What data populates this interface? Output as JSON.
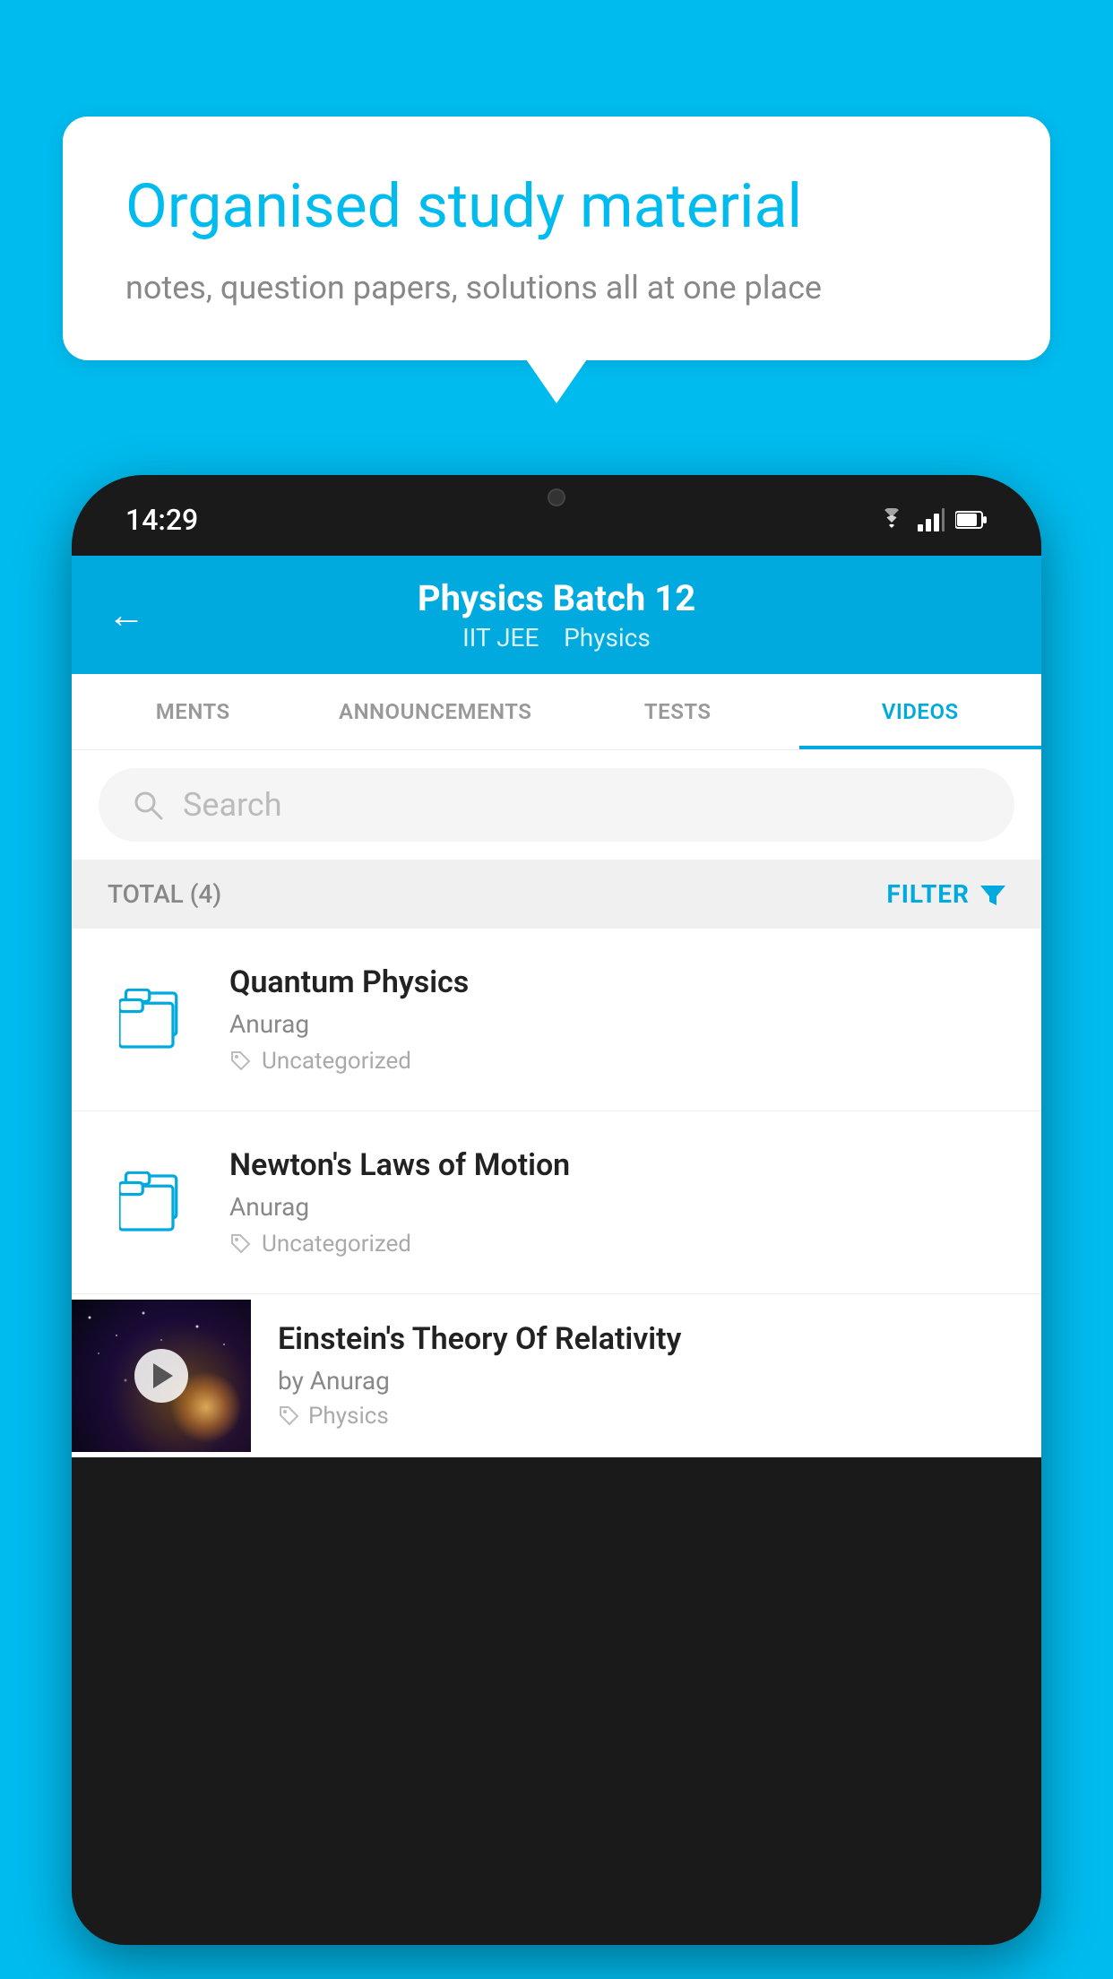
{
  "background_color": "#00BBEE",
  "speech_bubble": {
    "title": "Organised study material",
    "subtitle": "notes, question papers, solutions all at one place"
  },
  "phone": {
    "status_bar": {
      "time": "14:29"
    },
    "header": {
      "back_label": "←",
      "title": "Physics Batch 12",
      "subtitle_tag1": "IIT JEE",
      "subtitle_separator": "  ",
      "subtitle_tag2": "Physics"
    },
    "tabs": [
      {
        "label": "MENTS",
        "active": false
      },
      {
        "label": "ANNOUNCEMENTS",
        "active": false
      },
      {
        "label": "TESTS",
        "active": false
      },
      {
        "label": "VIDEOS",
        "active": true
      }
    ],
    "search": {
      "placeholder": "Search"
    },
    "filter_bar": {
      "total_label": "TOTAL (4)",
      "filter_label": "FILTER"
    },
    "items": [
      {
        "id": "quantum-physics",
        "title": "Quantum Physics",
        "author": "Anurag",
        "tag": "Uncategorized",
        "has_thumbnail": false
      },
      {
        "id": "newtons-laws",
        "title": "Newton's Laws of Motion",
        "author": "Anurag",
        "tag": "Uncategorized",
        "has_thumbnail": false
      },
      {
        "id": "einsteins-theory",
        "title": "Einstein's Theory Of Relativity",
        "author": "by Anurag",
        "tag": "Physics",
        "has_thumbnail": true
      }
    ]
  }
}
